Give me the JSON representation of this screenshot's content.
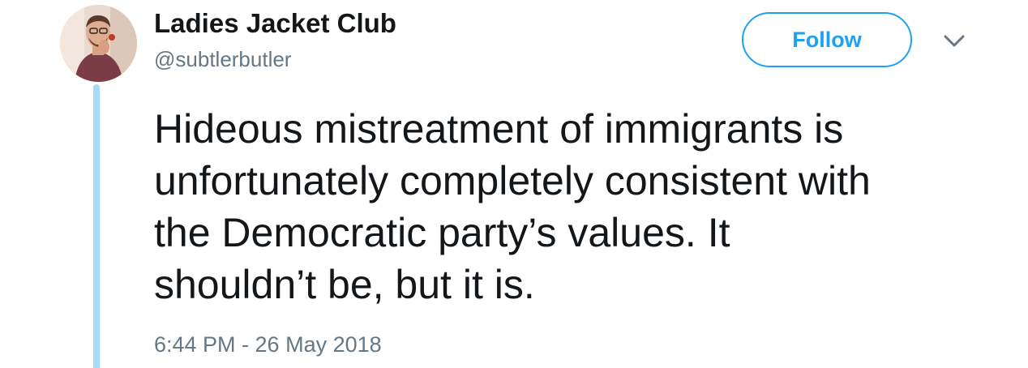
{
  "tweet": {
    "author": {
      "display_name": "Ladies Jacket Club",
      "handle": "@subtlerbutler"
    },
    "follow_label": "Follow",
    "text_lines": [
      "Hideous mistreatment of immigrants is",
      "unfortunately completely consistent with",
      "the Democratic party’s values. It",
      "shouldn’t be, but it is."
    ],
    "timestamp": "6:44 PM - 26 May 2018"
  },
  "icons": {
    "menu": "chevron-down-icon"
  },
  "colors": {
    "accent": "#1da1f2",
    "thread_line": "#a7dbf7",
    "text": "#14171a",
    "secondary_text": "#657786"
  }
}
